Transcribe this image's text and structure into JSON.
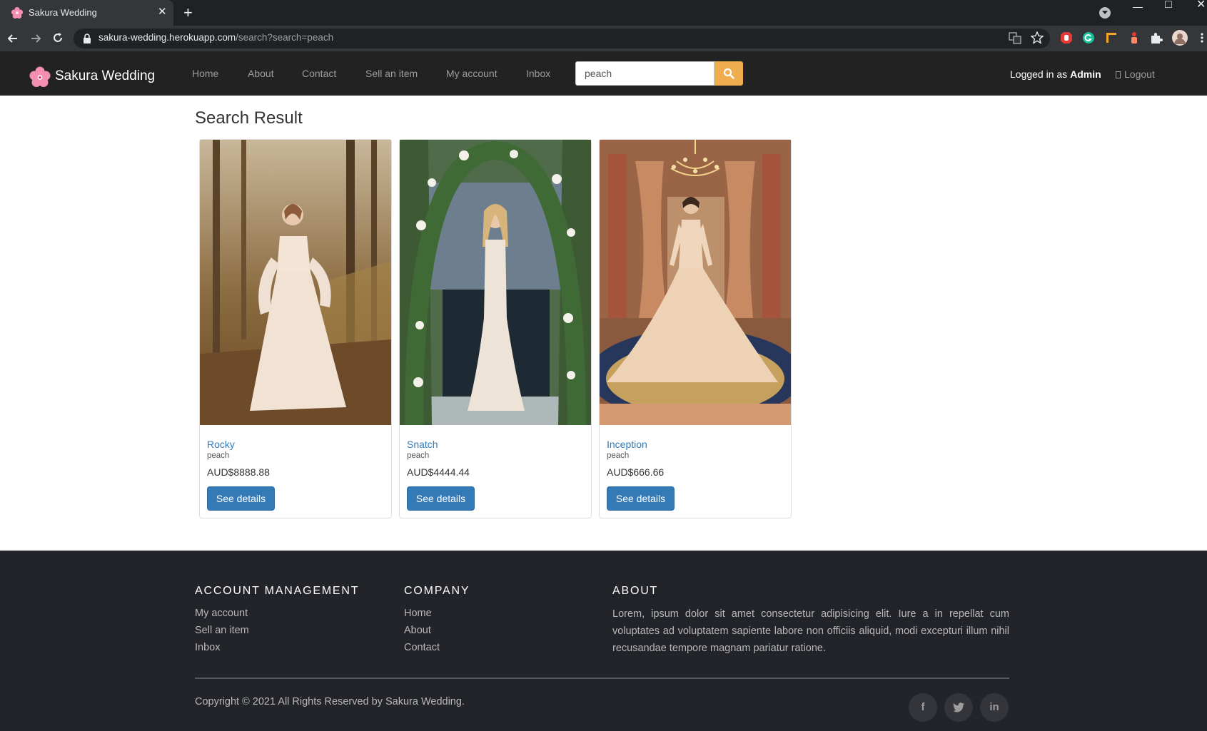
{
  "browser": {
    "tab_title": "Sakura Wedding",
    "url_host": "sakura-wedding.herokuapp.com",
    "url_path": "/search?search=peach"
  },
  "navbar": {
    "brand": "Sakura Wedding",
    "links": [
      "Home",
      "About",
      "Contact",
      "Sell an item",
      "My account",
      "Inbox"
    ],
    "search_value": "peach",
    "logged_in_prefix": "Logged in as",
    "logged_in_user": "Admin",
    "logout": "Logout"
  },
  "main": {
    "title": "Search Result",
    "products": [
      {
        "name": "Rocky",
        "color": "peach",
        "price": "AUD$8888.88",
        "button": "See details"
      },
      {
        "name": "Snatch",
        "color": "peach",
        "price": "AUD$4444.44",
        "button": "See details"
      },
      {
        "name": "Inception",
        "color": "peach",
        "price": "AUD$666.66",
        "button": "See details"
      }
    ]
  },
  "footer": {
    "account": {
      "heading": "ACCOUNT MANAGEMENT",
      "links": [
        "My account",
        "Sell an item",
        "Inbox"
      ]
    },
    "company": {
      "heading": "COMPANY",
      "links": [
        "Home",
        "About",
        "Contact"
      ]
    },
    "about": {
      "heading": "ABOUT",
      "text": "Lorem, ipsum dolor sit amet consectetur adipisicing elit. Iure a in repellat cum voluptates ad voluptatem sapiente labore non officiis aliquid, modi excepturi illum nihil recusandae tempore magnam pariatur ratione."
    },
    "copyright": "Copyright © 2021 All Rights Reserved by Sakura Wedding.",
    "social": [
      "f",
      "t",
      "in"
    ]
  }
}
